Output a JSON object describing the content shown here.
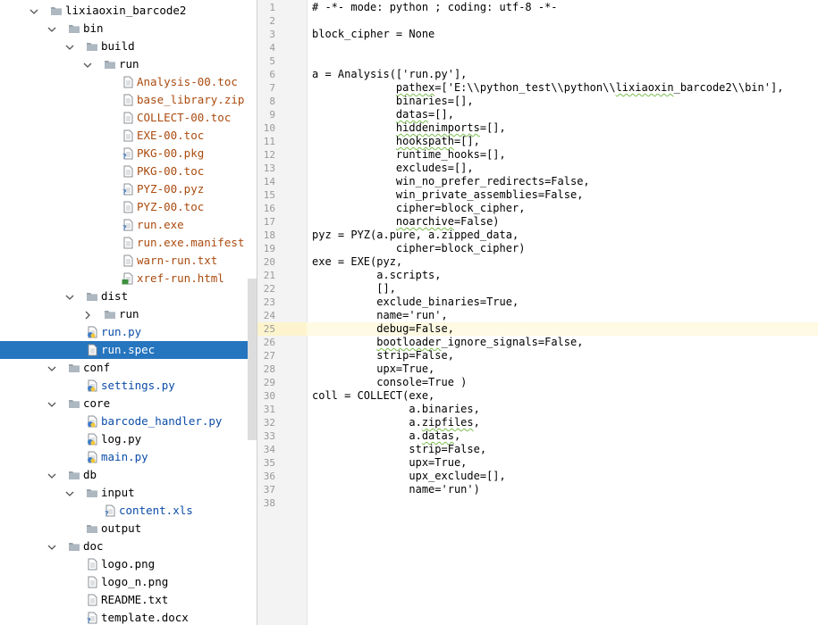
{
  "project_tree": {
    "items": [
      {
        "label": "lixiaoxin_barcode2",
        "kind": "folder",
        "color": "folder",
        "expanded": true
      },
      {
        "label": "bin",
        "kind": "folder",
        "color": "folder",
        "expanded": true
      },
      {
        "label": "build",
        "kind": "folder",
        "color": "folder",
        "expanded": true
      },
      {
        "label": "run",
        "kind": "folder",
        "color": "folder",
        "expanded": true
      },
      {
        "label": "Analysis-00.toc",
        "kind": "file",
        "color": "excluded"
      },
      {
        "label": "base_library.zip",
        "kind": "file",
        "color": "excluded"
      },
      {
        "label": "COLLECT-00.toc",
        "kind": "file",
        "color": "excluded"
      },
      {
        "label": "EXE-00.toc",
        "kind": "file",
        "color": "excluded"
      },
      {
        "label": "PKG-00.pkg",
        "kind": "file-unknown",
        "color": "excluded"
      },
      {
        "label": "PKG-00.toc",
        "kind": "file",
        "color": "excluded"
      },
      {
        "label": "PYZ-00.pyz",
        "kind": "file-unknown",
        "color": "excluded"
      },
      {
        "label": "PYZ-00.toc",
        "kind": "file",
        "color": "excluded"
      },
      {
        "label": "run.exe",
        "kind": "file-unknown",
        "color": "excluded"
      },
      {
        "label": "run.exe.manifest",
        "kind": "file",
        "color": "excluded"
      },
      {
        "label": "warn-run.txt",
        "kind": "file",
        "color": "excluded"
      },
      {
        "label": "xref-run.html",
        "kind": "file-html",
        "color": "excluded"
      },
      {
        "label": "dist",
        "kind": "folder",
        "color": "folder",
        "expanded": true
      },
      {
        "label": "run",
        "kind": "folder",
        "color": "folder",
        "expanded": false
      },
      {
        "label": "run.py",
        "kind": "file-python",
        "color": "vcs"
      },
      {
        "label": "run.spec",
        "kind": "file",
        "color": "plain",
        "selected": true
      },
      {
        "label": "conf",
        "kind": "folder",
        "color": "folder",
        "expanded": true
      },
      {
        "label": "settings.py",
        "kind": "file-python",
        "color": "vcs"
      },
      {
        "label": "core",
        "kind": "folder",
        "color": "folder",
        "expanded": true
      },
      {
        "label": "barcode_handler.py",
        "kind": "file-python",
        "color": "vcs"
      },
      {
        "label": "log.py",
        "kind": "file-python",
        "color": "plain"
      },
      {
        "label": "main.py",
        "kind": "file-python",
        "color": "vcs"
      },
      {
        "label": "db",
        "kind": "folder",
        "color": "folder",
        "expanded": true
      },
      {
        "label": "input",
        "kind": "folder",
        "color": "folder",
        "expanded": true
      },
      {
        "label": "content.xls",
        "kind": "file-unknown",
        "color": "vcs"
      },
      {
        "label": "output",
        "kind": "folder",
        "color": "folder",
        "expanded": null
      },
      {
        "label": "doc",
        "kind": "folder",
        "color": "folder",
        "expanded": true
      },
      {
        "label": "logo.png",
        "kind": "file",
        "color": "plain"
      },
      {
        "label": "logo_n.png",
        "kind": "file",
        "color": "plain"
      },
      {
        "label": "README.txt",
        "kind": "file",
        "color": "plain"
      },
      {
        "label": "template.docx",
        "kind": "file-unknown",
        "color": "plain"
      }
    ]
  },
  "editor": {
    "caret_line": 25,
    "lines": [
      "# -*- mode: python ; coding: utf-8 -*-",
      "",
      "block_cipher = None",
      "",
      "",
      "a = Analysis(['run.py'],",
      "             pathex=['E:\\\\python_test\\\\python\\\\lixiaoxin_barcode2\\\\bin'],",
      "             binaries=[],",
      "             datas=[],",
      "             hiddenimports=[],",
      "             hookspath=[],",
      "             runtime_hooks=[],",
      "             excludes=[],",
      "             win_no_prefer_redirects=False,",
      "             win_private_assemblies=False,",
      "             cipher=block_cipher,",
      "             noarchive=False)",
      "pyz = PYZ(a.pure, a.zipped_data,",
      "             cipher=block_cipher)",
      "exe = EXE(pyz,",
      "          a.scripts,",
      "          [],",
      "          exclude_binaries=True,",
      "          name='run',",
      "          debug=False,",
      "          bootloader_ignore_signals=False,",
      "          strip=False,",
      "          upx=True,",
      "          console=True )",
      "coll = COLLECT(exe,",
      "               a.binaries,",
      "               a.zipfiles,",
      "               a.datas,",
      "               strip=False,",
      "               upx=True,",
      "               upx_exclude=[],",
      "               name='run')",
      ""
    ]
  },
  "colors": {
    "selection": "#2675bf",
    "excluded_text": "#aa4b0f",
    "vcs_text": "#0b4da8",
    "caret_line": "#fefae3",
    "gutter": "#f3f3f3"
  }
}
